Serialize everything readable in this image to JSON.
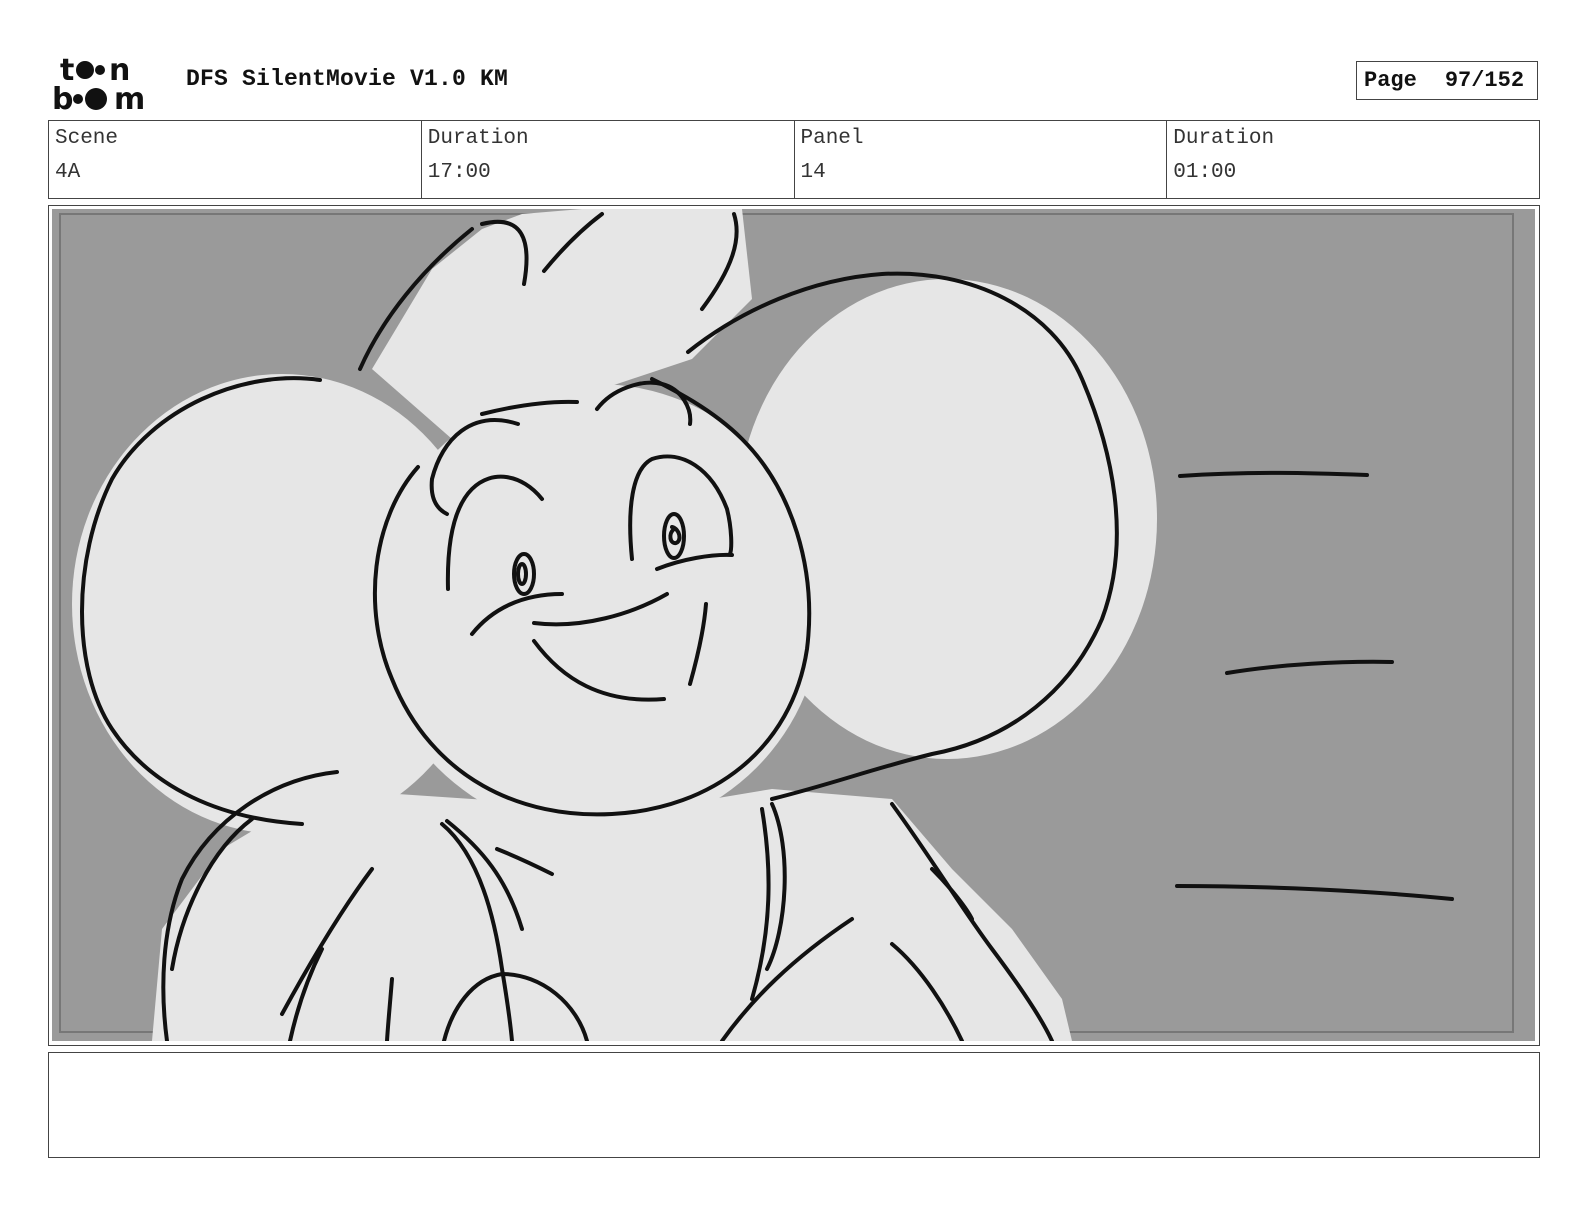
{
  "header": {
    "logo_text": "toon boom",
    "project_title": "DFS SilentMovie V1.0 KM",
    "page_label": "Page",
    "page_value": "97/152"
  },
  "info": {
    "scene_label": "Scene",
    "scene_value": "4A",
    "scene_duration_label": "Duration",
    "scene_duration_value": "17:00",
    "panel_label": "Panel",
    "panel_value": "14",
    "panel_duration_label": "Duration",
    "panel_duration_value": "01:00"
  },
  "panel": {
    "background_color": "#9a9a9a",
    "character_fill": "#e6e6e6",
    "line_color": "#111111"
  },
  "notes": {
    "text": ""
  }
}
